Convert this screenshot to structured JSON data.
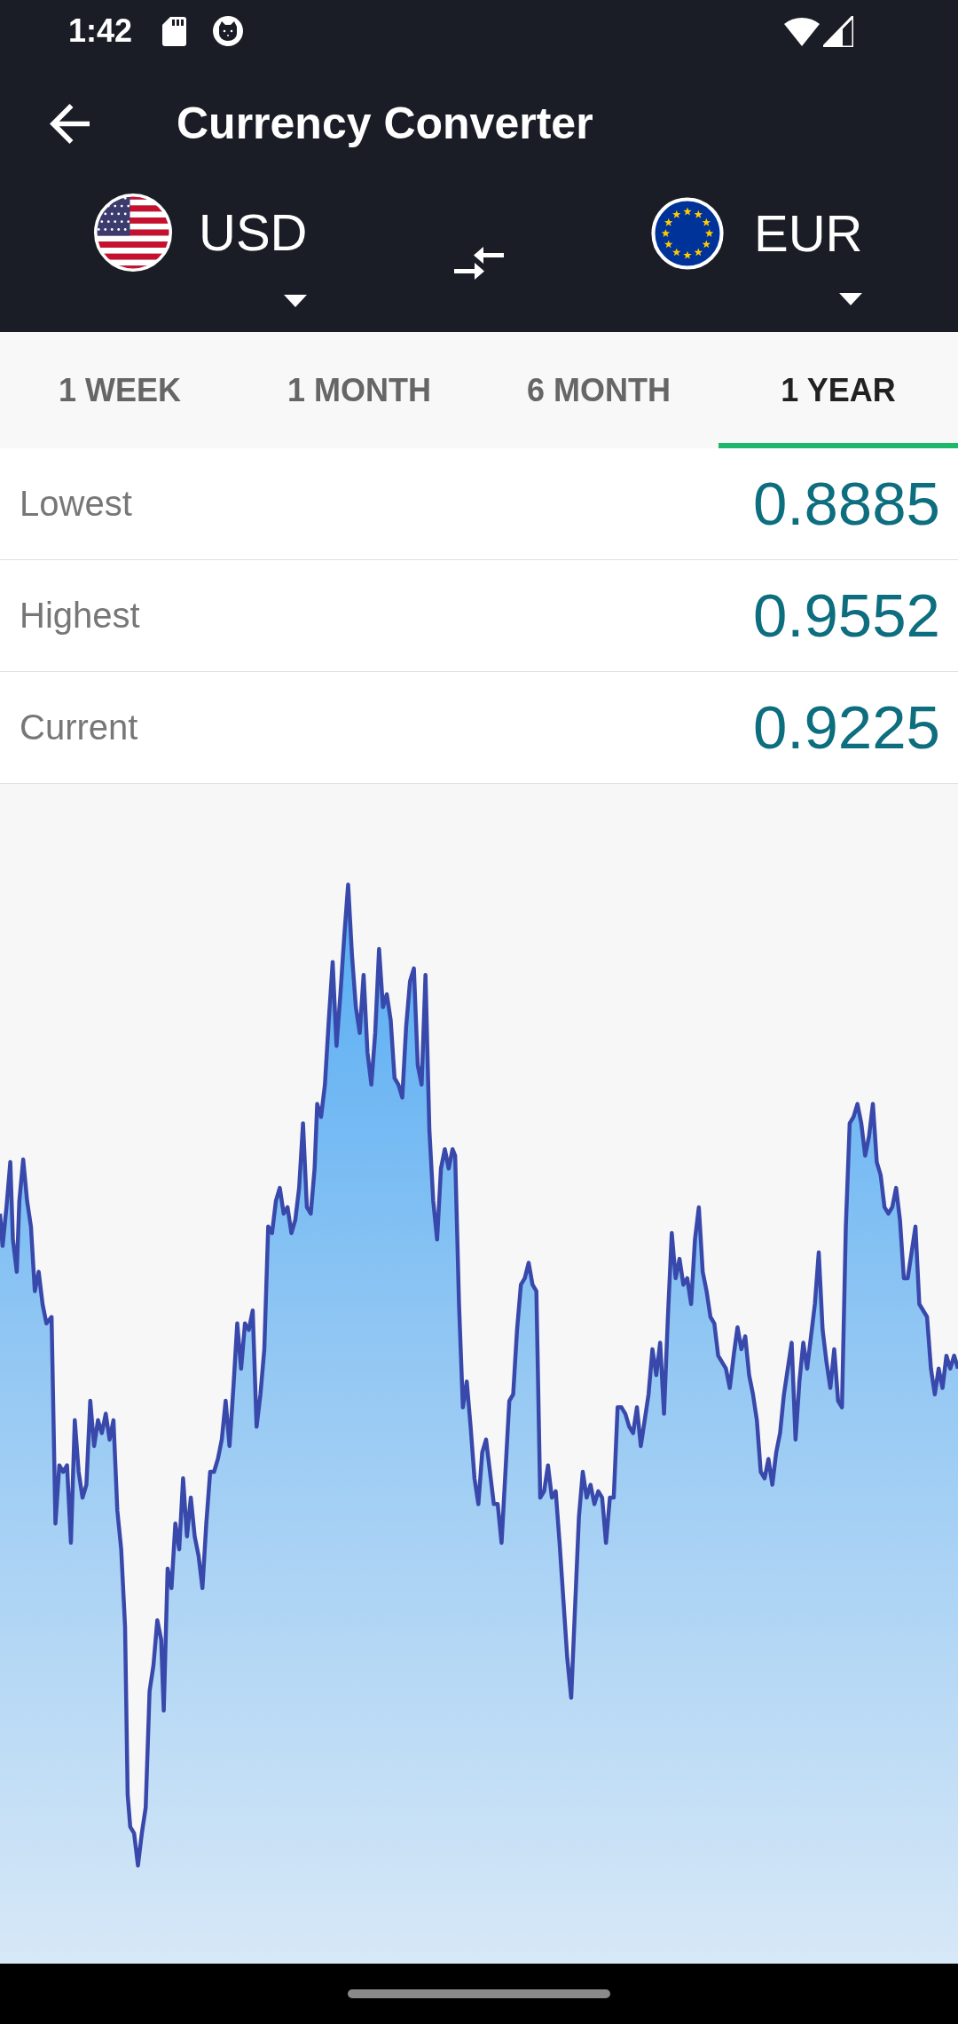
{
  "status_bar": {
    "time": "1:42"
  },
  "toolbar": {
    "title": "Currency Converter"
  },
  "converter": {
    "from": {
      "code": "USD"
    },
    "to": {
      "code": "EUR"
    }
  },
  "tabs": [
    {
      "label": "1 WEEK",
      "selected": false
    },
    {
      "label": "1 MONTH",
      "selected": false
    },
    {
      "label": "6 MONTH",
      "selected": false
    },
    {
      "label": "1 YEAR",
      "selected": true
    }
  ],
  "stats": [
    {
      "label": "Lowest",
      "value": "0.8885"
    },
    {
      "label": "Highest",
      "value": "0.9552"
    },
    {
      "label": "Current",
      "value": "0.9225"
    }
  ]
}
